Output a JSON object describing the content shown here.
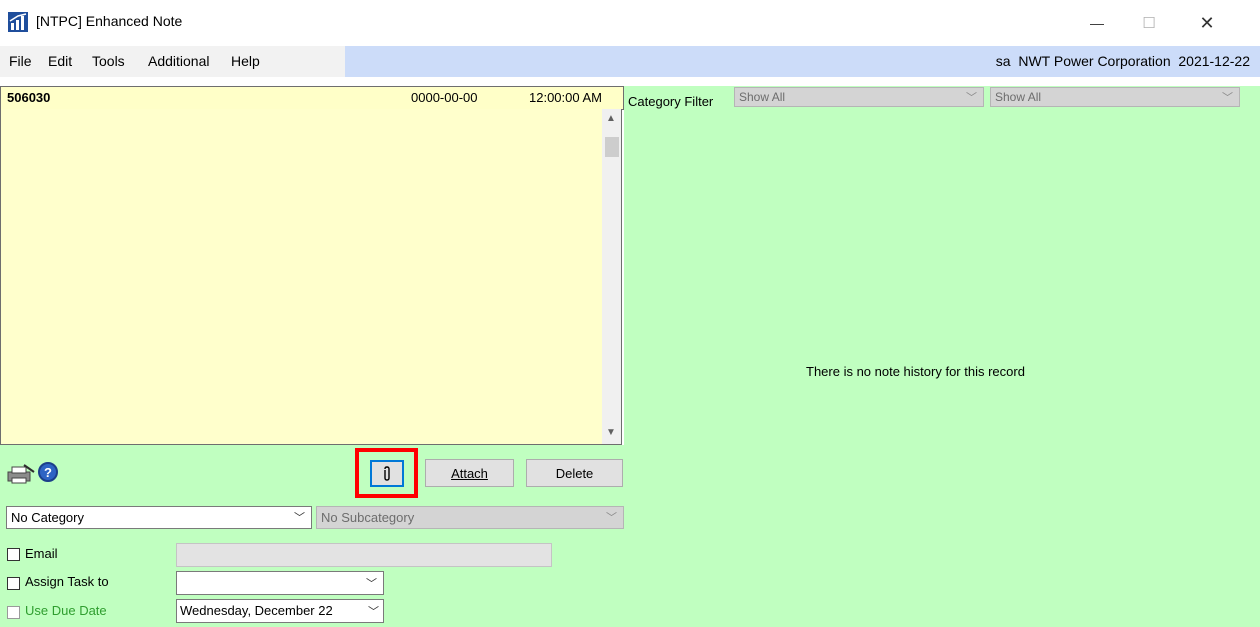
{
  "window": {
    "title": "[NTPC] Enhanced Note",
    "minimize_glyph": "—",
    "maximize_glyph": "☐",
    "close_glyph": "✕"
  },
  "menu": {
    "items": [
      "File",
      "Edit",
      "Tools",
      "Additional",
      "Help"
    ],
    "user_info": "sa  NWT Power Corporation  2021-12-22"
  },
  "note": {
    "id": "506030",
    "date": "0000-00-00",
    "time": "12:00:00 AM"
  },
  "filter": {
    "label": "Category Filter",
    "category_value": "Show All",
    "subcategory_value": "Show All"
  },
  "history": {
    "empty_message": "There is no note history for this record"
  },
  "toolbar": {
    "attach_label": "Attach",
    "delete_label": "Delete",
    "help_glyph": "?"
  },
  "category": {
    "value": "No Category",
    "subcategory_placeholder": "No Subcategory"
  },
  "options": {
    "email_label": "Email",
    "email_value": "",
    "assign_label": "Assign Task to",
    "assign_value": "",
    "due_label": "Use Due Date",
    "due_value": "Wednesday, December 22"
  },
  "colors": {
    "note_bg": "#ffffcc",
    "panel_green": "#c0ffc0",
    "menu_blue": "#ccdcf9",
    "highlight": "#ff0000",
    "due_label_color": "#2f9e2f"
  }
}
